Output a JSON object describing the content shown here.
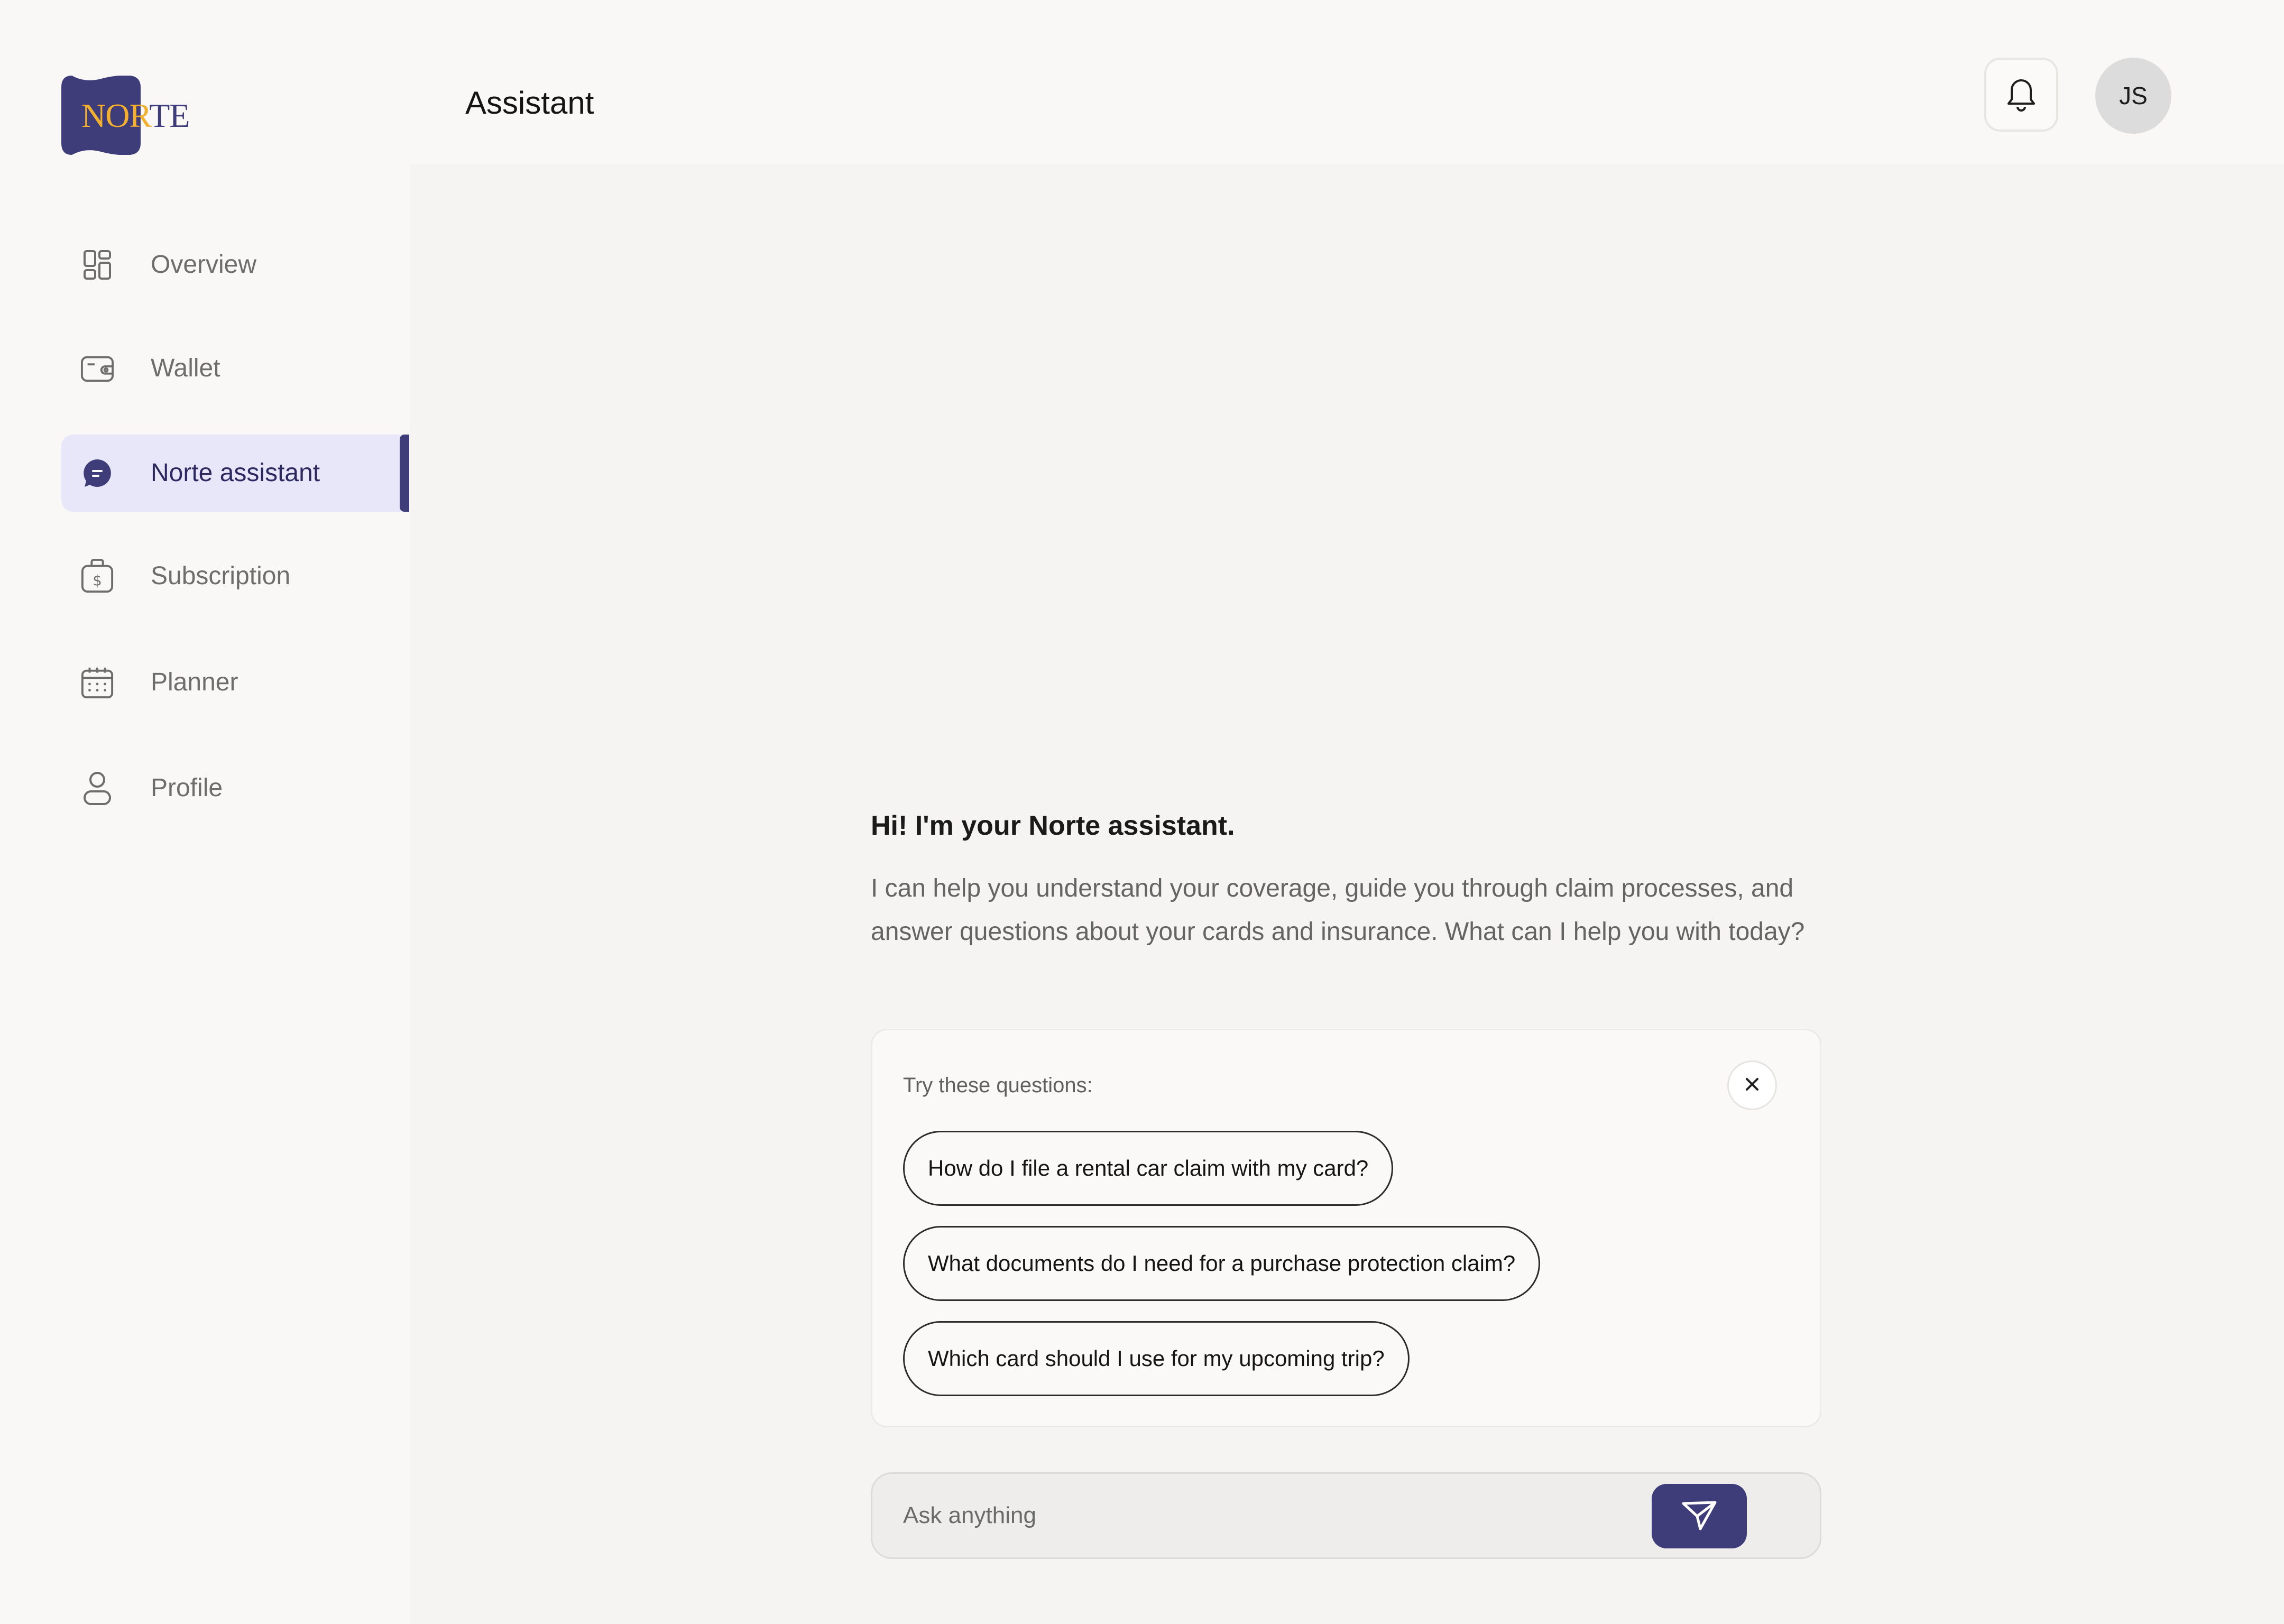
{
  "app": {
    "logo": {
      "text_part_1": "NOR",
      "text_part_2": "TE"
    },
    "brand_colors": {
      "primary": "#3f3c7a",
      "accent": "#f2b02e",
      "active_bg": "#e8e6f9"
    }
  },
  "sidebar": {
    "items": [
      {
        "label": "Overview",
        "icon": "grid-icon",
        "active": false
      },
      {
        "label": "Wallet",
        "icon": "wallet-icon",
        "active": false
      },
      {
        "label": "Norte assistant",
        "icon": "chat-bubble-icon",
        "active": true
      },
      {
        "label": "Subscription",
        "icon": "money-bag-icon",
        "active": false
      },
      {
        "label": "Planner",
        "icon": "calendar-icon",
        "active": false
      },
      {
        "label": "Profile",
        "icon": "user-icon",
        "active": false
      }
    ]
  },
  "header": {
    "title": "Assistant",
    "notification_icon": "bell-icon",
    "avatar_initials": "JS"
  },
  "assistant": {
    "greeting": "Hi! I'm your Norte assistant.",
    "intro": "I can help you understand your coverage, guide you through claim processes, and answer questions about your cards and insurance. What can I help you with today?",
    "suggestions": {
      "title": "Try these questions:",
      "close_icon": "close-icon",
      "items": [
        "How do I file a rental car claim with my card?",
        "What documents do I need for a purchase protection claim?",
        "Which card should I use for my upcoming trip?"
      ]
    },
    "input": {
      "placeholder": "Ask anything",
      "value": "",
      "send_icon": "send-icon"
    }
  }
}
